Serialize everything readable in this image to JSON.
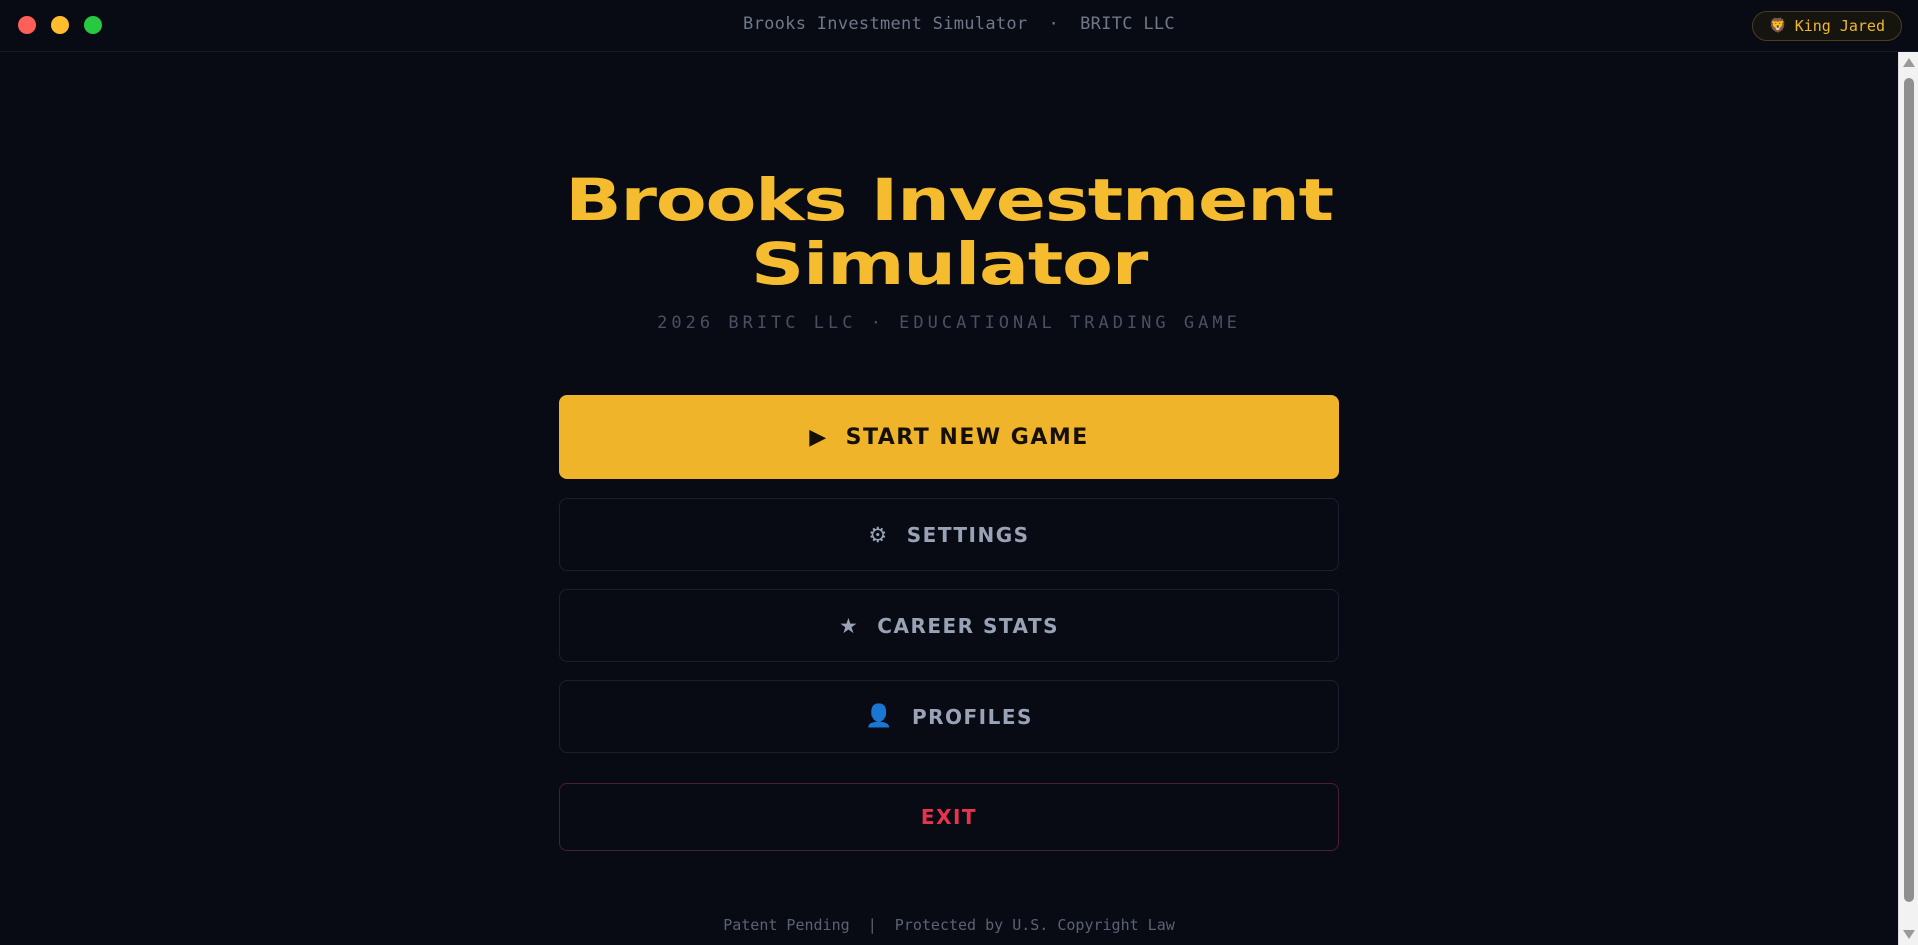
{
  "window": {
    "title": "Brooks Investment Simulator  ·  BRITC LLC",
    "user_icon": "🦁",
    "user_name": "King Jared"
  },
  "main": {
    "title_line1": "Brooks Investment",
    "title_line2": "Simulator",
    "subtitle": "2026 BRITC LLC · EDUCATIONAL TRADING GAME",
    "menu": {
      "start": {
        "icon": "▶",
        "label": "START NEW GAME"
      },
      "settings": {
        "icon": "⚙",
        "label": "SETTINGS"
      },
      "career": {
        "icon": "★",
        "label": "CAREER STATS"
      },
      "profiles": {
        "icon": "👤",
        "label": "PROFILES"
      },
      "exit": {
        "label": "EXIT"
      }
    },
    "footer": "Patent Pending  |  Protected by U.S. Copyright Law"
  },
  "colors": {
    "background": "#080b14",
    "accent": "#f0b42b",
    "exit": "#e8334f"
  }
}
